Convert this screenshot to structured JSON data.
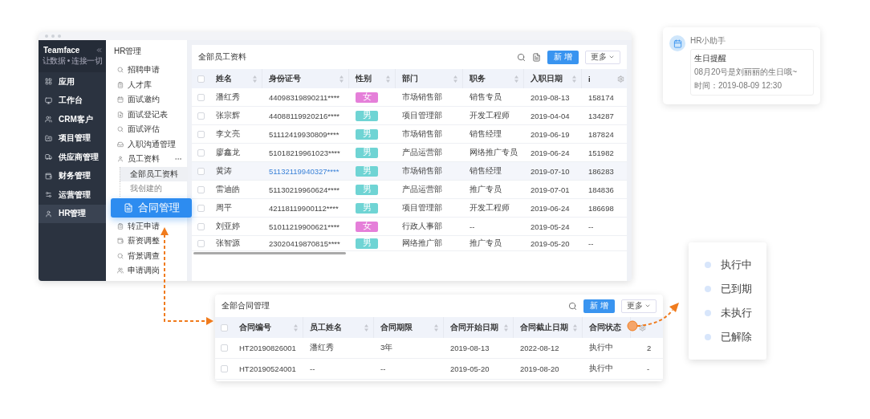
{
  "main_window": {
    "sidebar": {
      "logo": "Teamface",
      "slogan": "让数据 • 连接一切",
      "items": [
        {
          "label": "应用",
          "selected": false
        },
        {
          "label": "工作台",
          "selected": false
        },
        {
          "label": "CRM客户",
          "selected": false
        },
        {
          "label": "项目管理",
          "selected": false
        },
        {
          "label": "供应商管理",
          "selected": false
        },
        {
          "label": "财务管理",
          "selected": false
        },
        {
          "label": "运营管理",
          "selected": false
        },
        {
          "label": "HR管理",
          "selected": true
        }
      ]
    },
    "module_menu": {
      "title": "HR管理",
      "items": [
        {
          "label": "招聘申请",
          "highlighted": false
        },
        {
          "label": "人才库",
          "highlighted": false
        },
        {
          "label": "面试邀约",
          "highlighted": false
        },
        {
          "label": "面试登记表",
          "highlighted": false
        },
        {
          "label": "面试评估",
          "highlighted": false
        },
        {
          "label": "入职沟通管理",
          "highlighted": false
        },
        {
          "label": "员工资料",
          "highlighted": false,
          "children": [
            {
              "label": "全部员工资料",
              "selected": true
            },
            {
              "label": "我创建的",
              "selected": false
            }
          ]
        },
        {
          "label": "合同管理",
          "highlighted": true
        },
        {
          "label": "转正申请",
          "highlighted": false
        },
        {
          "label": "薪资调整",
          "highlighted": false
        },
        {
          "label": "背景调查",
          "highlighted": false
        },
        {
          "label": "申请调岗",
          "highlighted": false
        }
      ]
    },
    "table_card": {
      "title": "全部员工资料",
      "new_button": "新 增",
      "more_button": "更多",
      "header_checked": false,
      "columns": [
        "姓名",
        "身份证号",
        "性别",
        "部门",
        "职务",
        "入职日期",
        "i"
      ],
      "rows": [
        {
          "name": "潘红秀",
          "id_number": "44098319890211****",
          "gender": "女",
          "color": "#e57fd9",
          "department": "市场销售部",
          "position": "销售专员",
          "hire_date": "2019-08-13",
          "column_9": "158174",
          "highlighted": false,
          "checked": false
        },
        {
          "name": "张宗辉",
          "id_number": "44088119920216****",
          "gender": "男",
          "color": "#6fd4d4",
          "department": "项目管理部",
          "position": "开发工程师",
          "hire_date": "2019-04-04",
          "column_9": "134287",
          "highlighted": false,
          "checked": false
        },
        {
          "name": "李文亮",
          "id_number": "51112419930809****",
          "gender": "男",
          "color": "#6fd4d4",
          "department": "市场销售部",
          "position": "销售经理",
          "hire_date": "2019-06-19",
          "column_9": "187824",
          "highlighted": false,
          "checked": false
        },
        {
          "name": "廖鑫龙",
          "id_number": "51018219961023****",
          "gender": "男",
          "color": "#6fd4d4",
          "department": "产品运营部",
          "position": "网络推广专员",
          "hire_date": "2019-06-24",
          "column_9": "151982",
          "highlighted": false,
          "checked": false
        },
        {
          "name": "黄涛",
          "id_number": "51132119940327****",
          "gender": "男",
          "color": "#6fd4d4",
          "department": "市场销售部",
          "position": "销售经理",
          "hire_date": "2019-07-10",
          "column_9": "186283",
          "highlighted": true,
          "checked": false
        },
        {
          "name": "雷迪皓",
          "id_number": "51130219960624****",
          "gender": "男",
          "color": "#6fd4d4",
          "department": "产品运营部",
          "position": "推广专员",
          "hire_date": "2019-07-01",
          "column_9": "184836",
          "highlighted": false,
          "checked": false
        },
        {
          "name": "周平",
          "id_number": "42118119900112****",
          "gender": "男",
          "color": "#6fd4d4",
          "department": "项目管理部",
          "position": "开发工程师",
          "hire_date": "2019-06-24",
          "column_9": "186698",
          "highlighted": false,
          "checked": false
        },
        {
          "name": "刘亚婷",
          "id_number": "51011219900621****",
          "gender": "女",
          "color": "#e57fd9",
          "department": "行政人事部",
          "position": "--",
          "hire_date": "2019-05-24",
          "column_9": "--",
          "highlighted": false,
          "checked": false
        },
        {
          "name": "张智源",
          "id_number": "23020419870815****",
          "gender": "男",
          "color": "#6fd4d4",
          "department": "网络推广部",
          "position": "推广专员",
          "hire_date": "2019-05-20",
          "column_9": "--",
          "highlighted": false,
          "checked": false
        }
      ]
    }
  },
  "notification": {
    "sender": "HR小助手",
    "title": "生日提醒",
    "message": "08月20号是刘丽丽的生日哦~",
    "time": "时间：2019-08-09 12:30"
  },
  "contract_window": {
    "title": "全部合同管理",
    "new_button": "新 增",
    "more_button": "更多",
    "header_checked": false,
    "columns": [
      "合同编号",
      "员工姓名",
      "合同期限",
      "合同开始日期",
      "合同截止日期",
      "合同状态"
    ],
    "rows": [
      {
        "cells": [
          "HT20190826001",
          "潘红秀",
          "3年",
          "2019-08-13",
          "2022-08-12",
          "执行中"
        ],
        "column_8": "2",
        "checked": false
      },
      {
        "cells": [
          "HT20190524001",
          "--",
          "--",
          "2019-05-20",
          "2019-08-20",
          "执行中"
        ],
        "column_8": "-",
        "checked": false
      }
    ]
  },
  "status_options": [
    "执行中",
    "已到期",
    "未执行",
    "已解除"
  ]
}
